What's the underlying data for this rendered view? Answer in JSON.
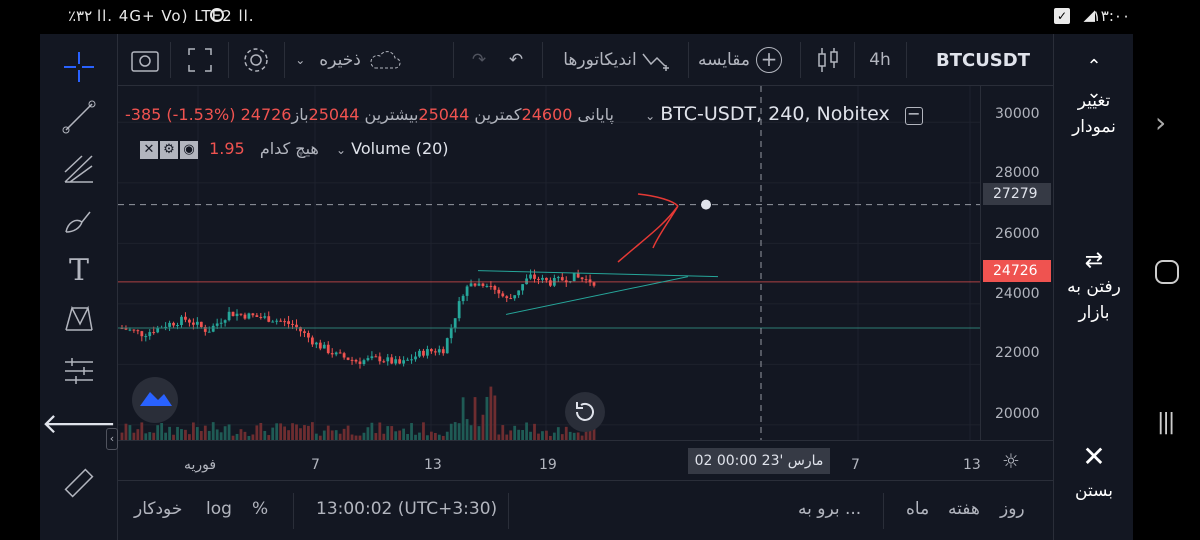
{
  "status_bar": {
    "left": "٪۳۲  ll.  4G+ Vo) LTE2 ll.",
    "time": "۱۳:۰۰"
  },
  "topbar": {
    "symbol": "BTCUSDT",
    "interval": "4h",
    "compare_label": "مقایسه",
    "indicators_label": "اندیکاتورها",
    "save_label": "ذخیره"
  },
  "legend": {
    "pair": "BTC-USDT, 240, Nobitex",
    "open_label": "باز",
    "open_value": "25044",
    "high_label": "بیشترین",
    "high_value": "25044",
    "low_label": "کمترین",
    "low_value": "24600",
    "close_label": "پایانی",
    "close_value": "24726",
    "change": "-385 (-1.53%)",
    "volume_name": "Volume (20)",
    "volume_value": "1.95",
    "volume_none": "هیچ کدام"
  },
  "price_axis": {
    "labels": [
      "30000",
      "28000",
      "26000",
      "24000",
      "22000",
      "20000"
    ],
    "crosshair_price": "27279",
    "last_price": "24726"
  },
  "time_axis": {
    "labels": [
      "فوریه",
      "7",
      "13",
      "19",
      "7",
      "13"
    ],
    "crosshair_time": "02 مارس '23   00:00"
  },
  "bottombar": {
    "day": "روز",
    "week": "هفته",
    "month": "ماه",
    "goto": "برو به ...",
    "clock": "13:00:02 (UTC+3:30)",
    "percent": "%",
    "log": "log",
    "auto": "خودکار"
  },
  "right_panel": {
    "change_chart_1": "تغییر",
    "change_chart_2": "نمودار",
    "market_1": "رفتن به",
    "market_2": "بازار",
    "close": "بستن"
  },
  "colors": {
    "bg": "#131722",
    "up": "#26a69a",
    "down": "#ef5350",
    "accent": "#2962ff"
  },
  "chart_data": {
    "type": "candlestick",
    "symbol": "BTCUSDT",
    "interval": "4h",
    "ylim": [
      19500,
      31200
    ],
    "x_ticks": [
      "فوریه",
      "7",
      "13",
      "19"
    ],
    "approx_close_path": [
      23200,
      23000,
      23300,
      23500,
      23100,
      23700,
      23600,
      23500,
      23300,
      22700,
      22300,
      22100,
      22200,
      22000,
      22400,
      22500,
      24600,
      24700,
      24100,
      24900,
      24700,
      24900,
      24726
    ],
    "last_close": 24726
  }
}
